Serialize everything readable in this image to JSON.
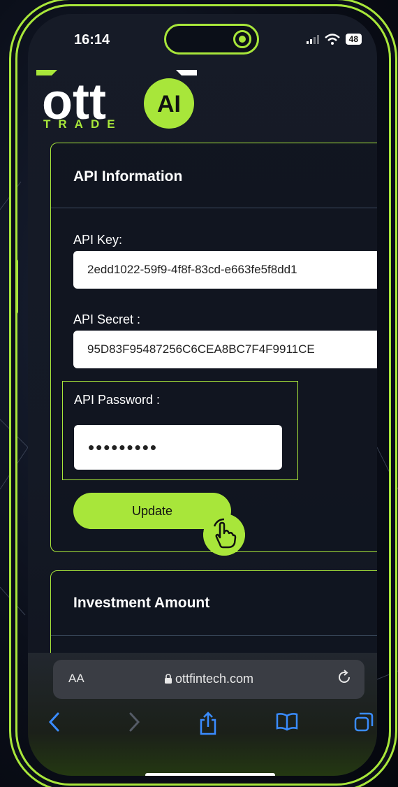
{
  "status": {
    "time": "16:14",
    "battery": "48"
  },
  "logo": {
    "wordmark": "ott",
    "badge": "AI",
    "subtitle": "TRADE"
  },
  "api_card": {
    "title": "API Information",
    "menu": "...",
    "api_key_label": "API Key:",
    "api_key_value": "2edd1022-59f9-4f8f-83cd-e663fe5f8dd1",
    "api_secret_label": "API Secret :",
    "api_secret_value": "95D83F95487256C6CEA8BC7F4F9911CE",
    "api_password_label": "API Password :",
    "api_password_value": "•••••••••",
    "update_label": "Update"
  },
  "investment_card": {
    "title": "Investment Amount",
    "menu": "..."
  },
  "browser": {
    "text_size": "AA",
    "url": "ottfintech.com"
  },
  "colors": {
    "accent": "#a8e63a",
    "link_blue": "#3a8cff"
  }
}
